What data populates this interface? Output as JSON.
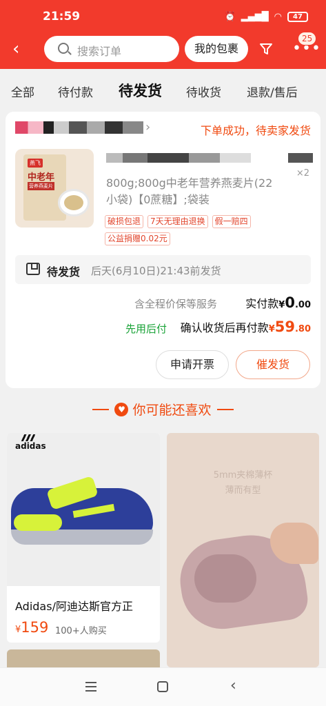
{
  "status_bar": {
    "time": "21:59",
    "battery": "47"
  },
  "header": {
    "search_placeholder": "搜索订单",
    "packages_button": "我的包裹",
    "badge_count": "25"
  },
  "tabs": [
    {
      "label": "全部"
    },
    {
      "label": "待付款"
    },
    {
      "label": "待发货"
    },
    {
      "label": "待收货"
    },
    {
      "label": "退款/售后"
    }
  ],
  "order": {
    "status": "下单成功，待卖家发货",
    "product": {
      "spec": "800g;800g中老年营养燕麦片(22小袋)【0蔗糖】;袋装",
      "quantity": "×2",
      "image_text": {
        "brand": "燕飞",
        "title": "中老年",
        "sub": "营养燕麦片"
      }
    },
    "tags": [
      "破损包退",
      "7天无理由退换",
      "假一赔四",
      "公益捐赠0.02元"
    ],
    "shipping": {
      "label": "待发货",
      "deadline": "后天(6月10日)21:43前发货"
    },
    "price_protect": "含全程价保等服务",
    "paid_label": "实付款",
    "paid_currency": "¥",
    "paid_int": "0",
    "paid_dec": ".00",
    "pay_later_label": "先用后付",
    "pay_later_text": "确认收货后再付款",
    "pay_later_currency": "¥",
    "pay_later_int": "59",
    "pay_later_dec": ".80",
    "buttons": {
      "invoice": "申请开票",
      "urge": "催发货"
    }
  },
  "recommend": {
    "title": "你可能还喜欢",
    "items": [
      {
        "brand_logo": "adidas",
        "name": "Adidas/阿迪达斯官方正",
        "currency": "¥",
        "price": "159",
        "sold": "100+人购买"
      },
      {
        "overlay_line1": "5mm夹棉薄杯",
        "overlay_line2": "薄而有型"
      }
    ]
  }
}
